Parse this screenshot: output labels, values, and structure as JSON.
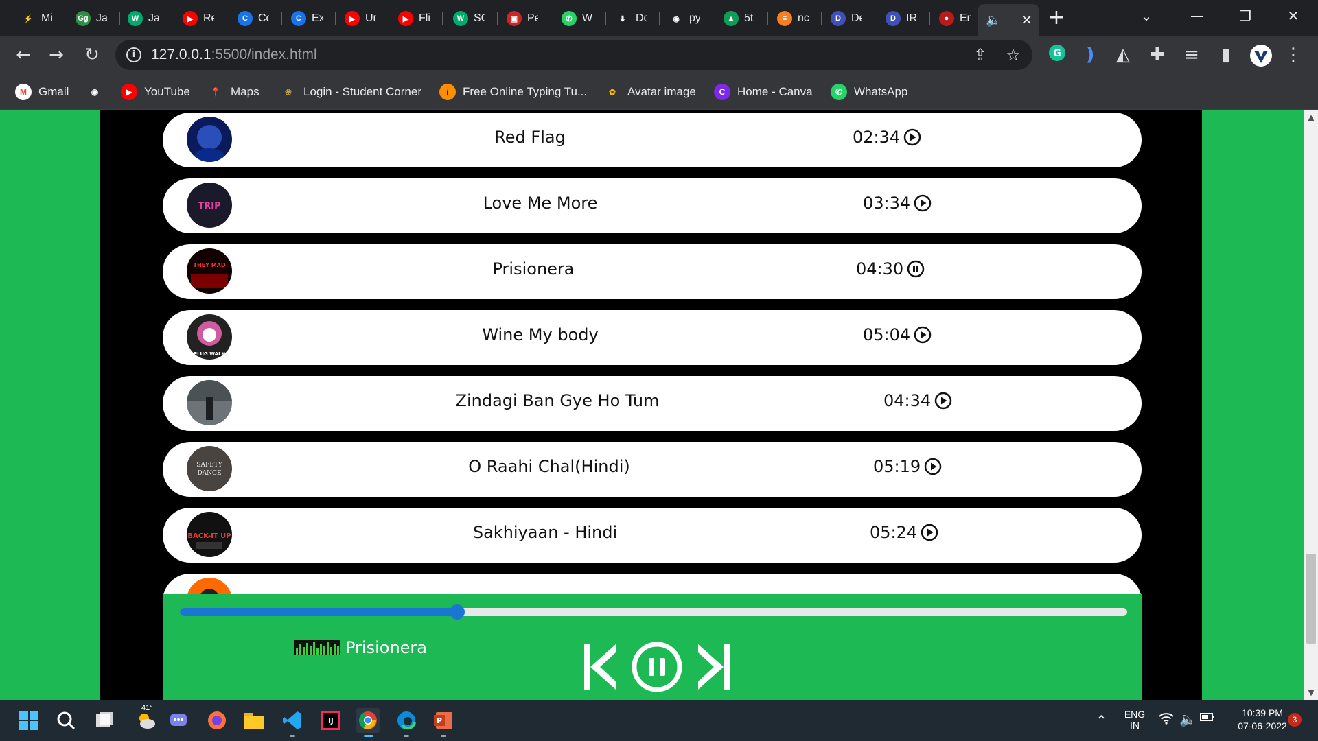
{
  "browser": {
    "tabs": [
      {
        "label": "Mi",
        "favicon": "ms-icon"
      },
      {
        "label": "Ja",
        "favicon": "gfg-icon"
      },
      {
        "label": "Ja",
        "favicon": "w3schools-icon"
      },
      {
        "label": "Re",
        "favicon": "youtube-icon"
      },
      {
        "label": "Cc",
        "favicon": "codechef-icon"
      },
      {
        "label": "Ex",
        "favicon": "codechef-icon"
      },
      {
        "label": "Ur",
        "favicon": "youtube-icon"
      },
      {
        "label": "Fli",
        "favicon": "youtube-icon"
      },
      {
        "label": "SC",
        "favicon": "w3schools-icon"
      },
      {
        "label": "Pe",
        "favicon": "box-icon"
      },
      {
        "label": "Wi",
        "favicon": "whatsapp-icon"
      },
      {
        "label": "Dc",
        "favicon": "download-icon"
      },
      {
        "label": "py",
        "favicon": "github-icon"
      },
      {
        "label": "5t",
        "favicon": "drive-icon"
      },
      {
        "label": "nc",
        "favicon": "stackoverflow-icon"
      },
      {
        "label": "De",
        "favicon": "doc-icon"
      },
      {
        "label": "IR",
        "favicon": "doc-icon"
      },
      {
        "label": "En",
        "favicon": "user-icon"
      }
    ],
    "active_tab_audio_icon": "speaker-icon",
    "url_host": "127.0.0.1",
    "url_path": ":5500/index.html"
  },
  "bookmarks": [
    {
      "label": "Gmail",
      "icon": "gmail-icon"
    },
    {
      "label": "",
      "icon": "github-icon"
    },
    {
      "label": "YouTube",
      "icon": "youtube-icon"
    },
    {
      "label": "Maps",
      "icon": "maps-icon"
    },
    {
      "label": "Login - Student Corner",
      "icon": "leaf-icon"
    },
    {
      "label": "Free Online Typing Tu...",
      "icon": "typing-icon"
    },
    {
      "label": "Avatar image",
      "icon": "photos-icon"
    },
    {
      "label": "Home - Canva",
      "icon": "canva-icon"
    },
    {
      "label": "WhatsApp",
      "icon": "whatsapp-icon"
    }
  ],
  "songs": [
    {
      "title": "Red Flag",
      "duration": "02:34",
      "state": "play"
    },
    {
      "title": "Love Me More",
      "duration": "03:34",
      "state": "play"
    },
    {
      "title": "Prisionera",
      "duration": "04:30",
      "state": "pause"
    },
    {
      "title": "Wine My body",
      "duration": "05:04",
      "state": "play"
    },
    {
      "title": "Zindagi Ban Gye Ho Tum",
      "duration": "04:34",
      "state": "play"
    },
    {
      "title": "O Raahi Chal(Hindi)",
      "duration": "05:19",
      "state": "play"
    },
    {
      "title": "Sakhiyaan - Hindi",
      "duration": "05:24",
      "state": "play"
    },
    {
      "title": "",
      "duration": "",
      "state": "play"
    }
  ],
  "player": {
    "now_playing": "Prisionera",
    "progress": 0.293
  },
  "taskbar": {
    "weather_temp": "41°",
    "lang": "ENG",
    "region": "IN",
    "time": "10:39 PM",
    "date": "07-06-2022",
    "notifications": "3"
  },
  "colors": {
    "page_green": "#1db954",
    "progress_blue": "#1976d2"
  }
}
